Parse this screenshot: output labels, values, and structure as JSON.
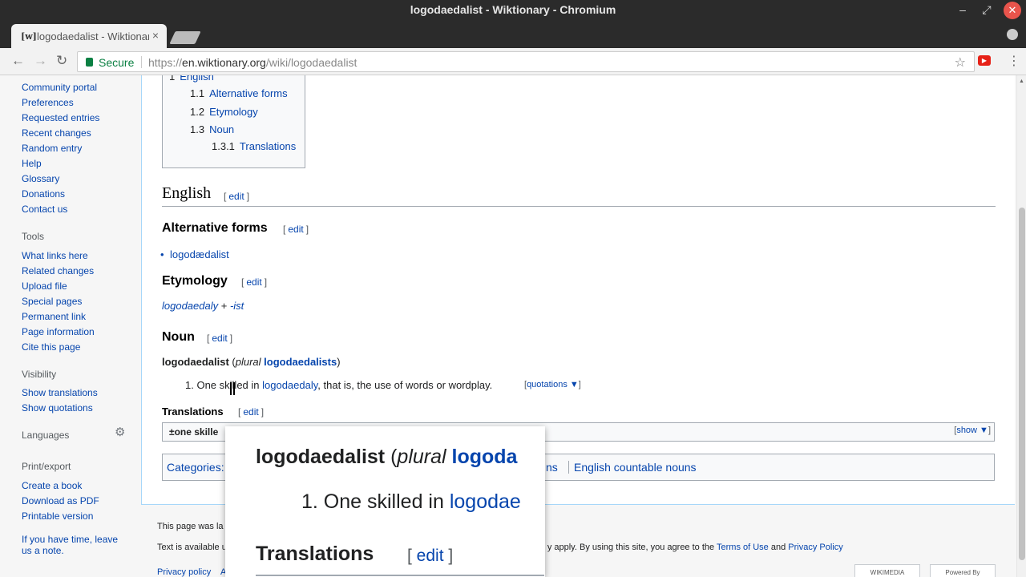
{
  "window": {
    "title": "logodaedalist - Wiktionary - Chromium"
  },
  "tab": {
    "favicon": "[w]",
    "title": "logodaedalist - Wiktionary",
    "close": "×"
  },
  "toolbar": {
    "secure": "Secure",
    "url_scheme": "https://",
    "url_host": "en.wiktionary.org",
    "url_path": "/wiki/logodaedalist"
  },
  "sidebar": {
    "nav": [
      "Community portal",
      "Preferences",
      "Requested entries",
      "Recent changes",
      "Random entry",
      "Help",
      "Glossary",
      "Donations",
      "Contact us"
    ],
    "tools_heading": "Tools",
    "tools": [
      "What links here",
      "Related changes",
      "Upload file",
      "Special pages",
      "Permanent link",
      "Page information",
      "Cite this page"
    ],
    "visibility_heading": "Visibility",
    "visibility": [
      "Show translations",
      "Show quotations"
    ],
    "languages_heading": "Languages",
    "print_heading": "Print/export",
    "print": [
      "Create a book",
      "Download as PDF",
      "Printable version"
    ],
    "note": "If you have time, leave us a note."
  },
  "toc": [
    {
      "num": "1",
      "label": "English"
    },
    {
      "num": "1.1",
      "label": "Alternative forms"
    },
    {
      "num": "1.2",
      "label": "Etymology"
    },
    {
      "num": "1.3",
      "label": "Noun"
    },
    {
      "num": "1.3.1",
      "label": "Translations"
    }
  ],
  "article": {
    "edit": "edit",
    "lang_heading": "English",
    "alt_heading": "Alternative forms",
    "alt_form": "logodædalist",
    "etym_heading": "Etymology",
    "etym_part1": "logodaedaly",
    "etym_plus": " + ",
    "etym_part2": "-ist",
    "noun_heading": "Noun",
    "headword": "logodaedalist",
    "plural_open": " (",
    "plural_label": "plural",
    "plural_form": "logodaedalists",
    "plural_close": ")",
    "def_num": "1.",
    "def_pre": "One skilled in ",
    "def_link": "logodaedaly",
    "def_post": ", that is, the use of words or wordplay.",
    "quotations": "quotations ▼",
    "trans_heading": "Translations",
    "trans_gloss": "±one skille",
    "trans_show": "show ▼",
    "categories_label": "Categories:",
    "cat_partial": "ns",
    "cat_item": "English countable nouns"
  },
  "footer": {
    "modified": "This page was la",
    "license_pre": "Text is available u",
    "license_post": "y apply. By using this site, you agree to the ",
    "terms": "Terms of Use",
    "and": " and ",
    "privacy": "Privacy Policy",
    "privacy_policy": "Privacy policy",
    "about_partial": "A",
    "badge1": "WIKIMEDIA",
    "badge2": "Powered By MediaWiki"
  },
  "popup": {
    "headword": "logodaedalist",
    "plural_open": " (",
    "plural_label": "plural",
    "plural_form": " logoda",
    "def_num": "1.",
    "def_pre": " One skilled in ",
    "def_link": "logodae",
    "trans_heading": "Translations",
    "edit": "edit"
  },
  "colors": {
    "link": "#0645ad",
    "content_border": "#a7d7f9",
    "secure": "#0b8043",
    "close": "#e9544c"
  }
}
